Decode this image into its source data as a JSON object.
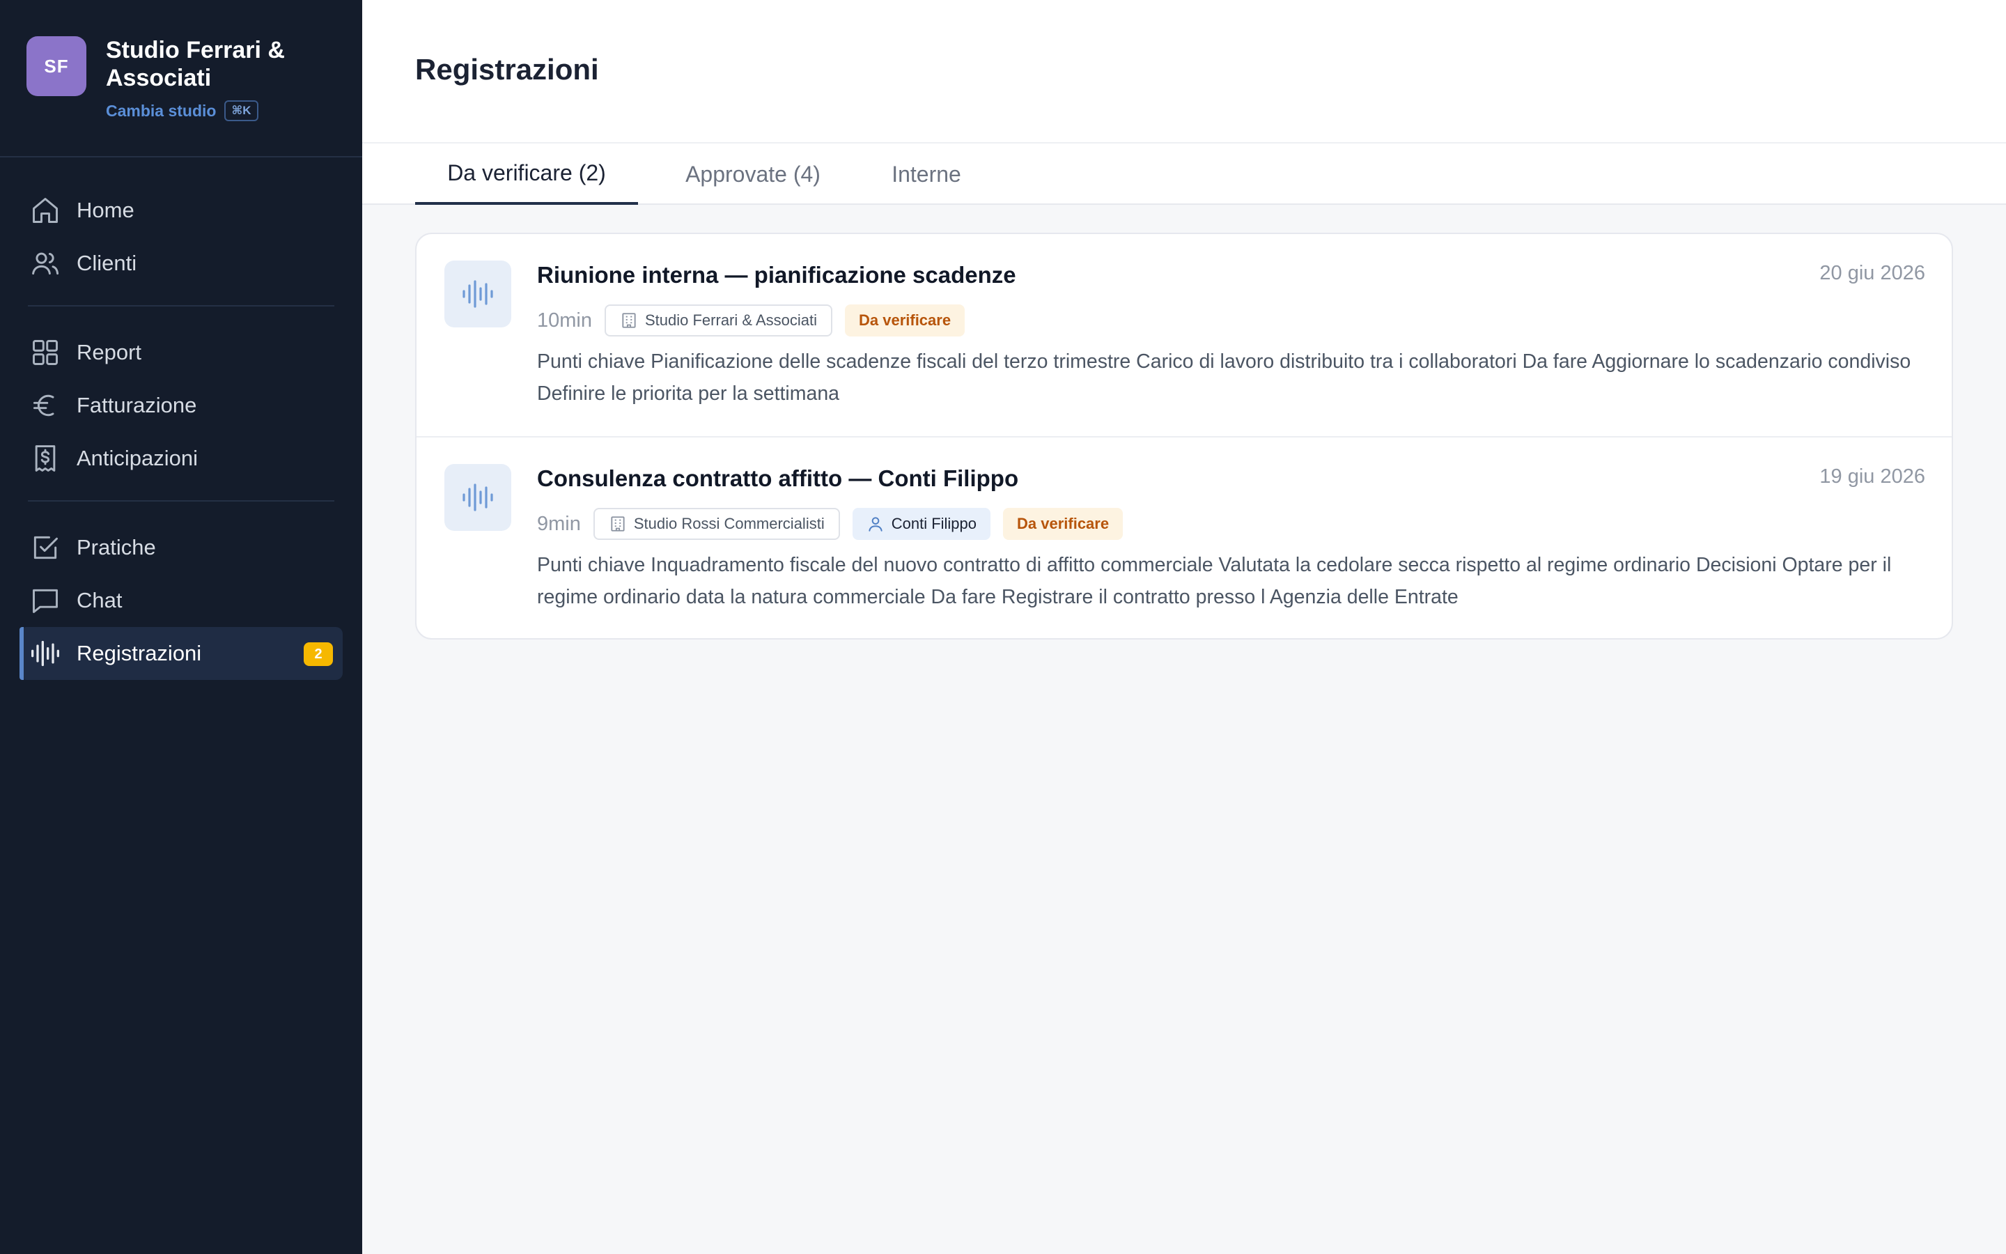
{
  "brand": {
    "initials": "SF",
    "name": "Studio Ferrari & Associati",
    "switch_label": "Cambia studio",
    "shortcut": "⌘K"
  },
  "sidebar": {
    "groups": [
      [
        {
          "label": "Home",
          "icon": "home-icon"
        },
        {
          "label": "Clienti",
          "icon": "users-icon"
        }
      ],
      [
        {
          "label": "Report",
          "icon": "grid-icon"
        },
        {
          "label": "Fatturazione",
          "icon": "euro-icon"
        },
        {
          "label": "Anticipazioni",
          "icon": "receipt-dollar-icon"
        }
      ],
      [
        {
          "label": "Pratiche",
          "icon": "checkbox-icon"
        },
        {
          "label": "Chat",
          "icon": "chat-icon"
        },
        {
          "label": "Registrazioni",
          "icon": "waveform-icon",
          "active": true,
          "badge": "2"
        }
      ]
    ]
  },
  "page": {
    "title": "Registrazioni"
  },
  "tabs": [
    {
      "label": "Da verificare (2)",
      "active": true
    },
    {
      "label": "Approvate (4)",
      "active": false
    },
    {
      "label": "Interne",
      "active": false
    }
  ],
  "recordings": [
    {
      "title": "Riunione interna — pianificazione scadenze",
      "date": "20 giu 2026",
      "duration": "10min",
      "studio": "Studio Ferrari & Associati",
      "client": null,
      "status": "Da verificare",
      "summary": "Punti chiave Pianificazione delle scadenze fiscali del terzo trimestre Carico di lavoro distribuito tra i collaboratori Da fare Aggiornare lo scadenzario condiviso Definire le priorita per la settimana"
    },
    {
      "title": "Consulenza contratto affitto — Conti Filippo",
      "date": "19 giu 2026",
      "duration": "9min",
      "studio": "Studio Rossi Commercialisti",
      "client": "Conti Filippo",
      "status": "Da verificare",
      "summary": "Punti chiave Inquadramento fiscale del nuovo contratto di affitto commerciale Valutata la cedolare secca rispetto al regime ordinario Decisioni Optare per il regime ordinario data la natura commerciale Da fare Registrare il contratto presso l Agenzia delle Entrate"
    }
  ],
  "colors": {
    "sidebar_bg": "#141c2b",
    "accent": "#5a86c9",
    "badge": "#f6b800",
    "status_text": "#b7550b",
    "status_bg": "#fdf3e1",
    "avatar": "#8b74c9"
  }
}
